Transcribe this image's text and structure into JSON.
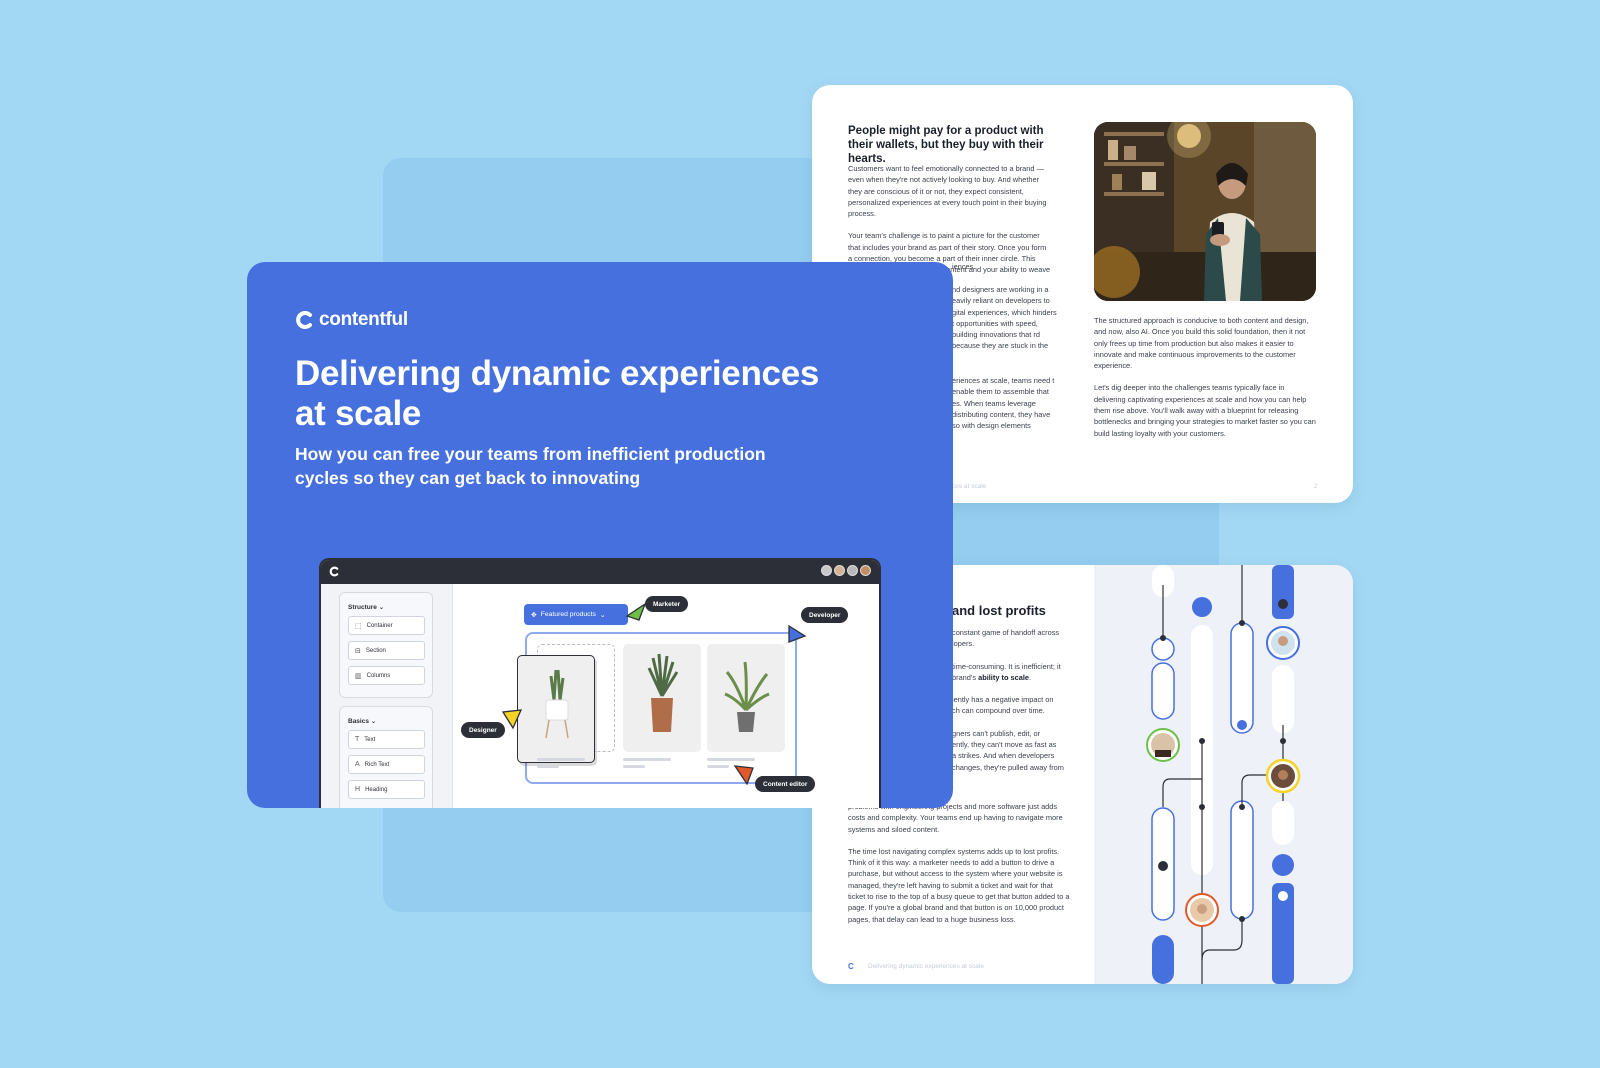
{
  "cover": {
    "brand": "contentful",
    "title": "Delivering dynamic experiences at scale",
    "subtitle": "How you can free your teams from inefficient production cycles so they can get back to innovating"
  },
  "app": {
    "sidebar": {
      "structure_label": "Structure",
      "structure_items": [
        "Container",
        "Section",
        "Columns"
      ],
      "basics_label": "Basics",
      "basics_items": [
        "Text",
        "Rich Text",
        "Heading"
      ]
    },
    "featured_label": "Featured products",
    "tags": {
      "marketer": "Marketer",
      "developer": "Developer",
      "designer": "Designer",
      "content_editor": "Content editor"
    },
    "cursor_colors": {
      "marketer": "#6cc04a",
      "developer": "#4670de",
      "designer": "#f5d327",
      "content_editor": "#e0582b"
    }
  },
  "page1": {
    "heading": "People might pay for a product with their wallets, but they buy with their hearts.",
    "left_paragraphs": [
      "Customers want to feel emotionally connected to a brand — even when they're not actively looking to buy. And whether they are conscious of it or not, they expect consistent, personalized experiences at every touch point in their buying process.",
      "Your team's challenge is to paint a picture for the customer that includes your brand as part of their story. Once you form a connection, you become a part of their inner circle. This whole connection starts with content and your ability to weave that",
      "nd designers are working in a eavily reliant on developers to gital experiences, which hinders t opportunities with speed, building innovations that rd because they are stuck in the",
      "eriences at scale, teams need t enable them to assemble that es. When teams leverage distributing content, they have so with design elements"
    ],
    "left_fragment": "iences.",
    "right_paragraphs": [
      "The structured approach is conducive to both content and design, and now, also AI. Once you build this solid foundation, then it not only frees up time from production but also makes it easier to innovate and make continuous improvements to the customer experience.",
      "Let's dig deeper into the challenges teams typically face in delivering captivating experiences at scale and how you can help them rise above. You'll walk away with a blueprint for releasing bottlenecks and bringing your strategies to market faster so you can build lasting loyalty with your customers."
    ],
    "footer_left": "ces at scale",
    "page_number": "2"
  },
  "page2": {
    "heading_fragment": "and lost profits",
    "fragments": [
      "constant game of handoff across",
      "lopers.",
      "time-consuming. It is inefficient; it",
      "brand's",
      "ability to scale",
      "iently has a negative impact on",
      "ch can compound over time.",
      "gners can't publish, edit, or",
      "ently, they can't move as fast as",
      "a strikes. And when developers",
      "changes, they're pulled away from"
    ],
    "paragraphs": [
      "problems with engineering projects and more software just adds costs and complexity. Your teams end up having to navigate more systems and siloed content.",
      "The time lost navigating complex systems adds up to lost profits. Think of it this way: a marketer needs to add a button to drive a purchase, but without access to the system where your website is managed, they're left having to submit a ticket and wait for that ticket to rise to the top of a busy queue to get that button added to a page. If you're a global brand and that button is on 10,000 product pages, that delay can lead to a huge business loss."
    ],
    "footer": "Delivering dynamic experiences at scale"
  },
  "colors": {
    "background": "#a3d8f4",
    "cover_blue": "#4670de",
    "accent_blue": "#4670de"
  }
}
